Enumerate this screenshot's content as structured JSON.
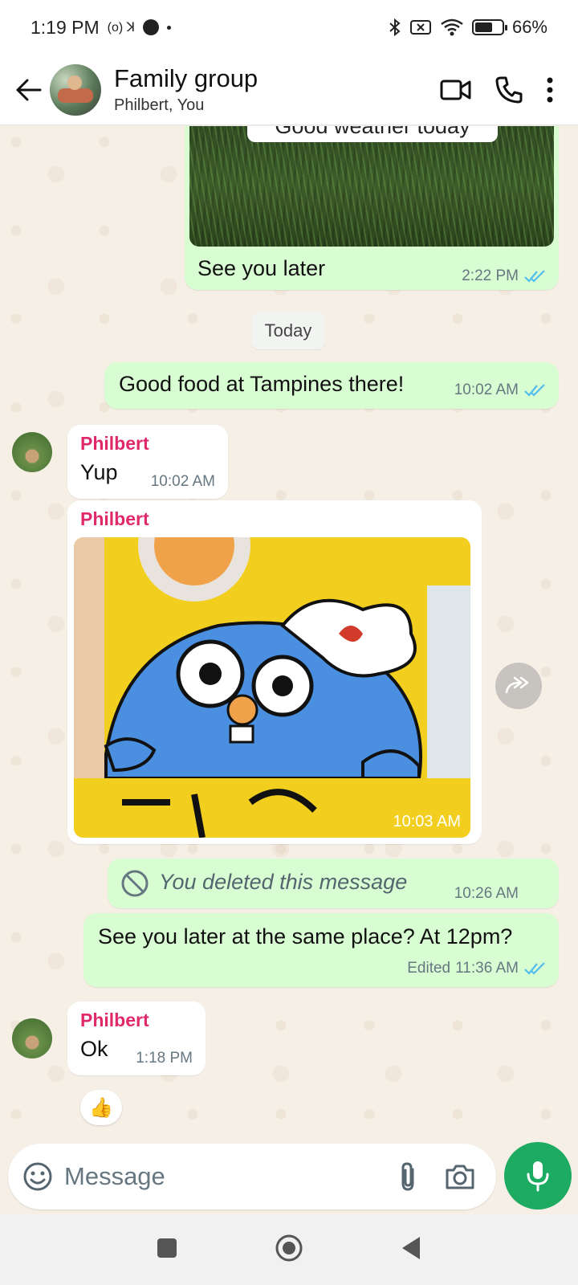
{
  "status_bar": {
    "time": "1:19 PM",
    "extra": "(o) ꓘ",
    "battery": "66%",
    "battery_level": 0.66
  },
  "header": {
    "title": "Family group",
    "subtitle": "Philbert, You"
  },
  "messages": {
    "m1": {
      "caption": "Good weather today",
      "text": "See you later",
      "time": "2:22 PM"
    },
    "date_chip": "Today",
    "m2": {
      "text": "Good food at Tampines there!",
      "time": "10:02 AM"
    },
    "m3": {
      "sender": "Philbert",
      "text": "Yup",
      "time": "10:02 AM"
    },
    "m4": {
      "sender": "Philbert",
      "time": "10:03 AM"
    },
    "m5": {
      "text": "You deleted this message",
      "time": "10:26 AM"
    },
    "m6": {
      "text": "See you later at the same place? At 12pm?",
      "edited": "Edited",
      "time": "11:36 AM"
    },
    "m7": {
      "sender": "Philbert",
      "text": "Ok",
      "time": "1:18 PM",
      "reaction": "👍"
    }
  },
  "composer": {
    "placeholder": "Message"
  },
  "colors": {
    "accent": "#1daa61",
    "outgoing": "#d9fdd3",
    "incoming": "#ffffff",
    "sender": "#e0296a",
    "tick": "#53bdeb"
  }
}
